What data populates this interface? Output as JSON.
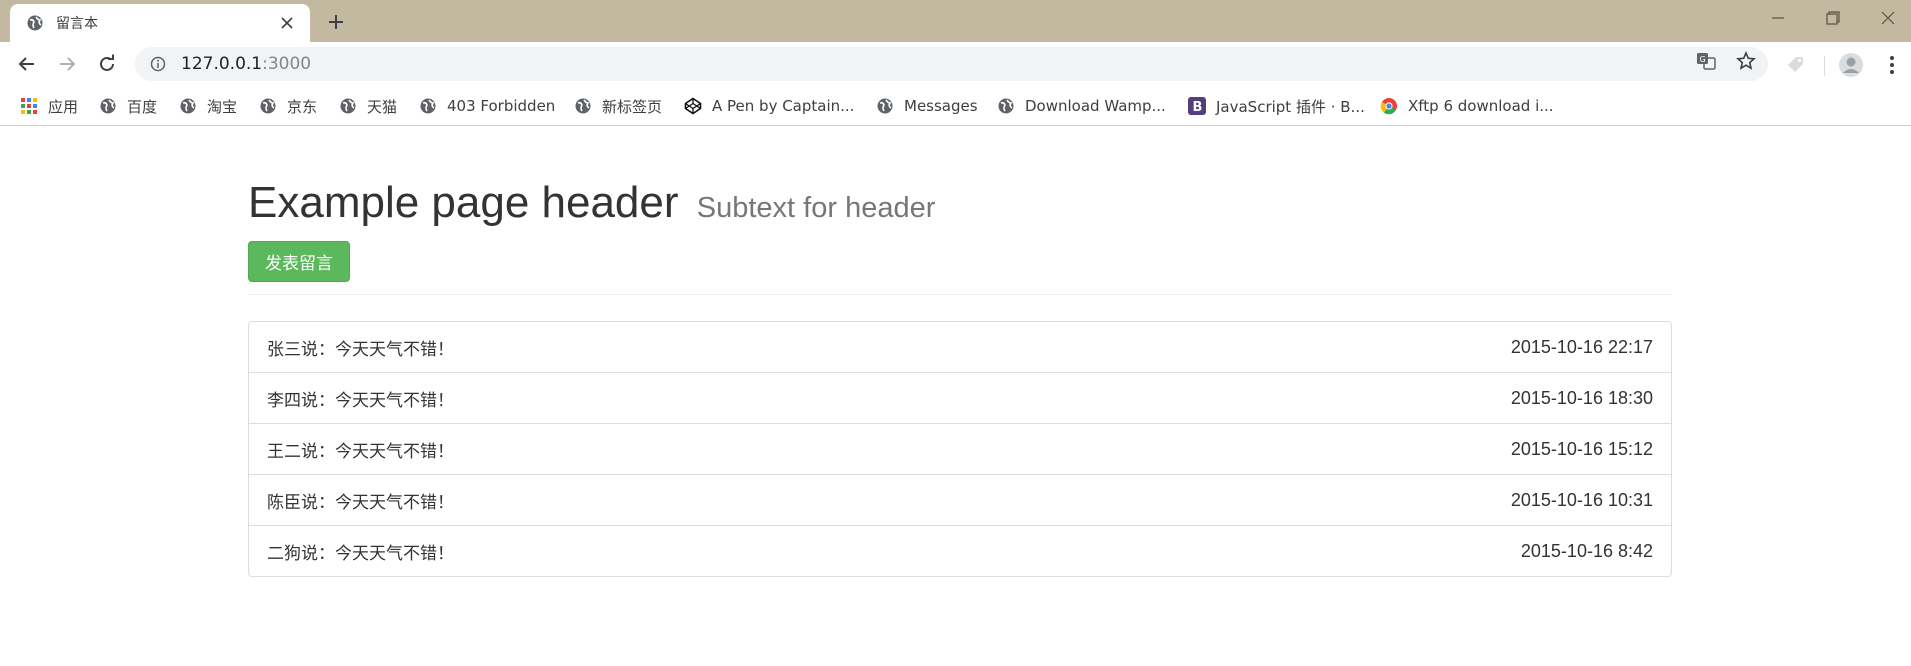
{
  "browser": {
    "tab": {
      "title": "留言本"
    },
    "address": {
      "host": "127.0.0.1",
      "port": ":3000"
    }
  },
  "bookmarks": [
    {
      "label": "应用",
      "icon": "apps-grid-icon"
    },
    {
      "label": "百度",
      "icon": "globe-icon"
    },
    {
      "label": "淘宝",
      "icon": "globe-icon"
    },
    {
      "label": "京东",
      "icon": "globe-icon"
    },
    {
      "label": "天猫",
      "icon": "globe-icon"
    },
    {
      "label": "403 Forbidden",
      "icon": "globe-icon"
    },
    {
      "label": "新标签页",
      "icon": "globe-icon"
    },
    {
      "label": "A Pen by Captain...",
      "icon": "codepen-icon"
    },
    {
      "label": "Messages",
      "icon": "globe-icon"
    },
    {
      "label": "Download Wamp...",
      "icon": "globe-icon"
    },
    {
      "label": "JavaScript 插件 · B...",
      "icon": "bootstrap-icon"
    },
    {
      "label": "Xftp 6 download i...",
      "icon": "chrome-icon"
    }
  ],
  "page": {
    "title": "Example page header",
    "subtitle": "Subtext for header",
    "post_button": "发表留言"
  },
  "messages": [
    {
      "text": "张三说：今天天气不错！",
      "time": "2015-10-16 22:17"
    },
    {
      "text": "李四说：今天天气不错！",
      "time": "2015-10-16 18:30"
    },
    {
      "text": "王二说：今天天气不错！",
      "time": "2015-10-16 15:12"
    },
    {
      "text": "陈臣说：今天天气不错！",
      "time": "2015-10-16 10:31"
    },
    {
      "text": "二狗说：今天天气不错！",
      "time": "2015-10-16 8:42"
    }
  ]
}
